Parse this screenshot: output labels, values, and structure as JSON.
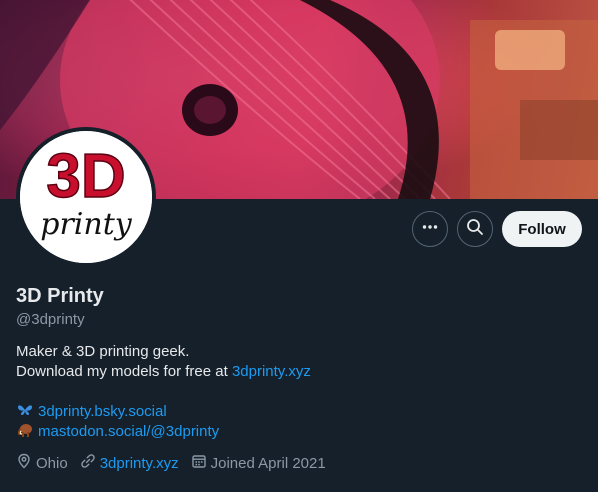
{
  "profile": {
    "name": "3D Printy",
    "handle": "@3dprinty",
    "avatar_text_top": "3D",
    "avatar_text_bottom": "printy",
    "bio_line1": "Maker & 3D printing geek.",
    "bio_line2_prefix": "Download my models for free at ",
    "bio_line2_link": "3dprinty.xyz",
    "links": [
      {
        "icon": "butterfly-icon",
        "text": "3dprinty.bsky.social"
      },
      {
        "icon": "mammoth-icon",
        "text": "mastodon.social/@3dprinty"
      }
    ],
    "location": "Ohio",
    "website": "3dprinty.xyz",
    "joined": "Joined April 2021"
  },
  "actions": {
    "more_icon": "more-icon",
    "search_icon": "search-icon",
    "follow_label": "Follow"
  },
  "colors": {
    "background": "#15202b",
    "link": "#1d9bf0",
    "muted": "#8b98a5",
    "avatar_red": "#c8102e"
  }
}
